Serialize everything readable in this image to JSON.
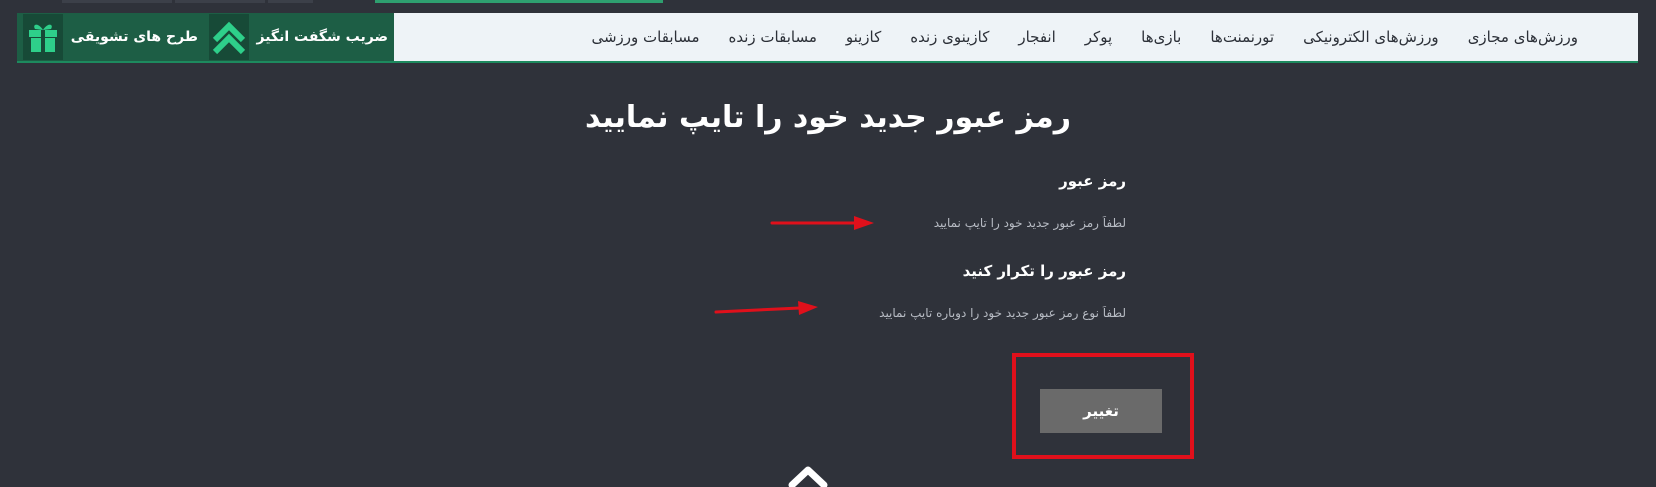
{
  "navbar": {
    "promos": [
      {
        "label": "ضریب شگفت انگیز",
        "icon": "double-chevron-up-icon"
      },
      {
        "label": "طرح های تشویقی",
        "icon": "gift-icon"
      }
    ],
    "menu": [
      "مسابقات ورزشی",
      "مسابقات زنده",
      "کازینو",
      "کازینوی زنده",
      "انفجار",
      "پوکر",
      "بازی‌ها",
      "تورنمنت‌ها",
      "ورزش‌های الکترونیکی",
      "ورزش‌های مجازی"
    ]
  },
  "form": {
    "title": "رمز عبور جدید خود را تایپ نمایید",
    "password_label": "رمز عبور",
    "password_placeholder": "لطفاً رمز عبور جدید خود را تایپ نمایید",
    "confirm_label": "رمز عبور را تکرار کنید",
    "confirm_placeholder": "لطفاً نوع رمز عبور جدید خود را دوباره تایپ نمایید",
    "submit_label": "تغییر"
  },
  "colors": {
    "background": "#2f323a",
    "navbar_bg": "#eef3f7",
    "promo_bg": "#1d5e45",
    "accent_green": "#2ecf8a",
    "annotation_red": "#e0101b",
    "button_bg": "#6a6a6a"
  },
  "icons": [
    "gift-icon",
    "double-chevron-up-icon",
    "chevron-up-icon",
    "red-arrow-annotation"
  ]
}
